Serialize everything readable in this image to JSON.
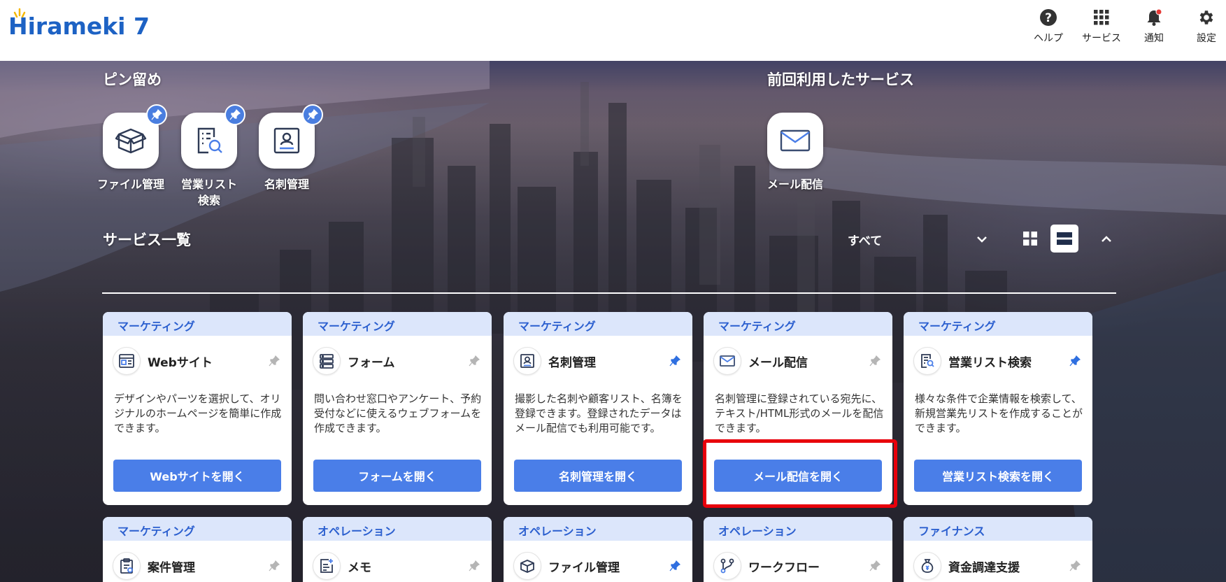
{
  "header": {
    "logo_text": "Hirameki 7",
    "items": [
      {
        "label": "ヘルプ",
        "icon": "help-icon"
      },
      {
        "label": "サービス",
        "icon": "grid-icon"
      },
      {
        "label": "通知",
        "icon": "bell-icon"
      },
      {
        "label": "設定",
        "icon": "gear-icon"
      }
    ]
  },
  "pinned": {
    "title": "ピン留め",
    "items": [
      {
        "label": "ファイル管理",
        "icon": "box-icon"
      },
      {
        "label": "営業リスト\n検索",
        "icon": "list-search-icon"
      },
      {
        "label": "名刺管理",
        "icon": "business-card-icon"
      }
    ]
  },
  "recent": {
    "title": "前回利用したサービス",
    "items": [
      {
        "label": "メール配信",
        "icon": "mail-icon"
      }
    ]
  },
  "services": {
    "title": "サービス一覧",
    "filter_value": "すべて",
    "cards": [
      {
        "category": "マーケティング",
        "name": "Webサイト",
        "icon": "website-icon",
        "pinned": false,
        "desc": "デザインやパーツを選択して、オリジナルのホームページを簡単に作成できます。",
        "button": "Webサイトを開く"
      },
      {
        "category": "マーケティング",
        "name": "フォーム",
        "icon": "form-icon",
        "pinned": false,
        "desc": "問い合わせ窓口やアンケート、予約受付などに使えるウェブフォームを作成できます。",
        "button": "フォームを開く"
      },
      {
        "category": "マーケティング",
        "name": "名刺管理",
        "icon": "business-card-icon",
        "pinned": true,
        "desc": "撮影した名刺や顧客リスト、名簿を登録できます。登録されたデータはメール配信でも利用可能です。",
        "button": "名刺管理を開く"
      },
      {
        "category": "マーケティング",
        "name": "メール配信",
        "icon": "mail-icon",
        "pinned": false,
        "desc": "名刺管理に登録されている宛先に、テキスト/HTML形式のメールを配信できます。",
        "button": "メール配信を開く"
      },
      {
        "category": "マーケティング",
        "name": "営業リスト検索",
        "icon": "list-search-icon",
        "pinned": true,
        "desc": "様々な条件で企業情報を検索して、新規営業先リストを作成することができます。",
        "button": "営業リスト検索を開く"
      },
      {
        "category": "マーケティング",
        "name": "案件管理",
        "icon": "clipboard-icon",
        "pinned": false
      },
      {
        "category": "オペレーション",
        "name": "メモ",
        "icon": "memo-icon",
        "pinned": false
      },
      {
        "category": "オペレーション",
        "name": "ファイル管理",
        "icon": "box-icon",
        "pinned": true
      },
      {
        "category": "オペレーション",
        "name": "ワークフロー",
        "icon": "workflow-icon",
        "pinned": false
      },
      {
        "category": "ファイナンス",
        "name": "資金調達支援",
        "icon": "money-bag-icon",
        "pinned": false
      }
    ]
  },
  "colors": {
    "accent": "#4a7ee8",
    "brand": "#1d62c4",
    "highlight": "#e8000b",
    "category_bg": "#dce6fb"
  }
}
